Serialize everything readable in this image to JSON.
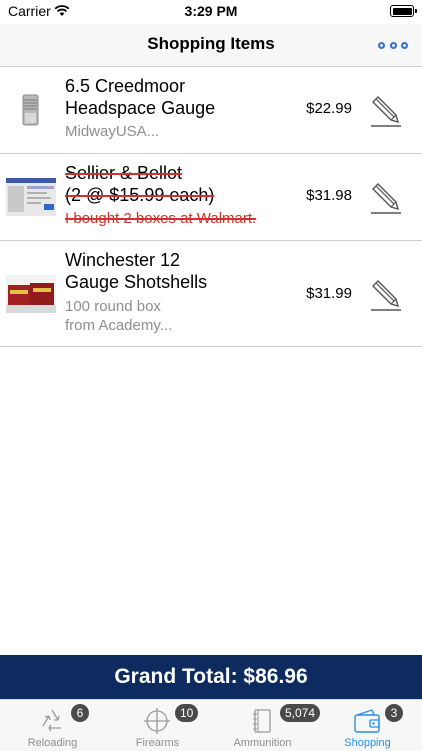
{
  "status_bar": {
    "carrier": "Carrier",
    "time": "3:29 PM"
  },
  "nav": {
    "title": "Shopping Items",
    "more_icon": "ellipsis-icon"
  },
  "items": [
    {
      "title_line1": "6.5 Creedmoor",
      "title_line2": "Headspace Gauge",
      "note_line1": "MidwayUSA...",
      "note_line2": "",
      "price": "$22.99",
      "purchased": false
    },
    {
      "title_line1": "Sellier & Bellot",
      "title_line2": "(2 @ $15.99 each)",
      "note_line1": "I bought 2 boxes at Walmart.",
      "note_line2": "",
      "price": "$31.98",
      "purchased": true
    },
    {
      "title_line1": "Winchester 12",
      "title_line2": "Gauge Shotshells",
      "note_line1": "100 round box",
      "note_line2": "from Academy...",
      "price": "$31.99",
      "purchased": false
    }
  ],
  "grand_total": "Grand Total: $86.96",
  "tabs": [
    {
      "label": "Reloading",
      "badge": "6",
      "icon": "recycle-icon",
      "active": false
    },
    {
      "label": "Firearms",
      "badge": "10",
      "icon": "crosshair-icon",
      "active": false
    },
    {
      "label": "Ammunition",
      "badge": "5,074",
      "icon": "notebook-icon",
      "active": false
    },
    {
      "label": "Shopping",
      "badge": "3",
      "icon": "wallet-icon",
      "active": true
    }
  ],
  "colors": {
    "accent": "#2f6fd6",
    "grand_total_bg": "#0d2b5e",
    "strike": "#d0312d",
    "active_tab": "#2b8fe6"
  }
}
